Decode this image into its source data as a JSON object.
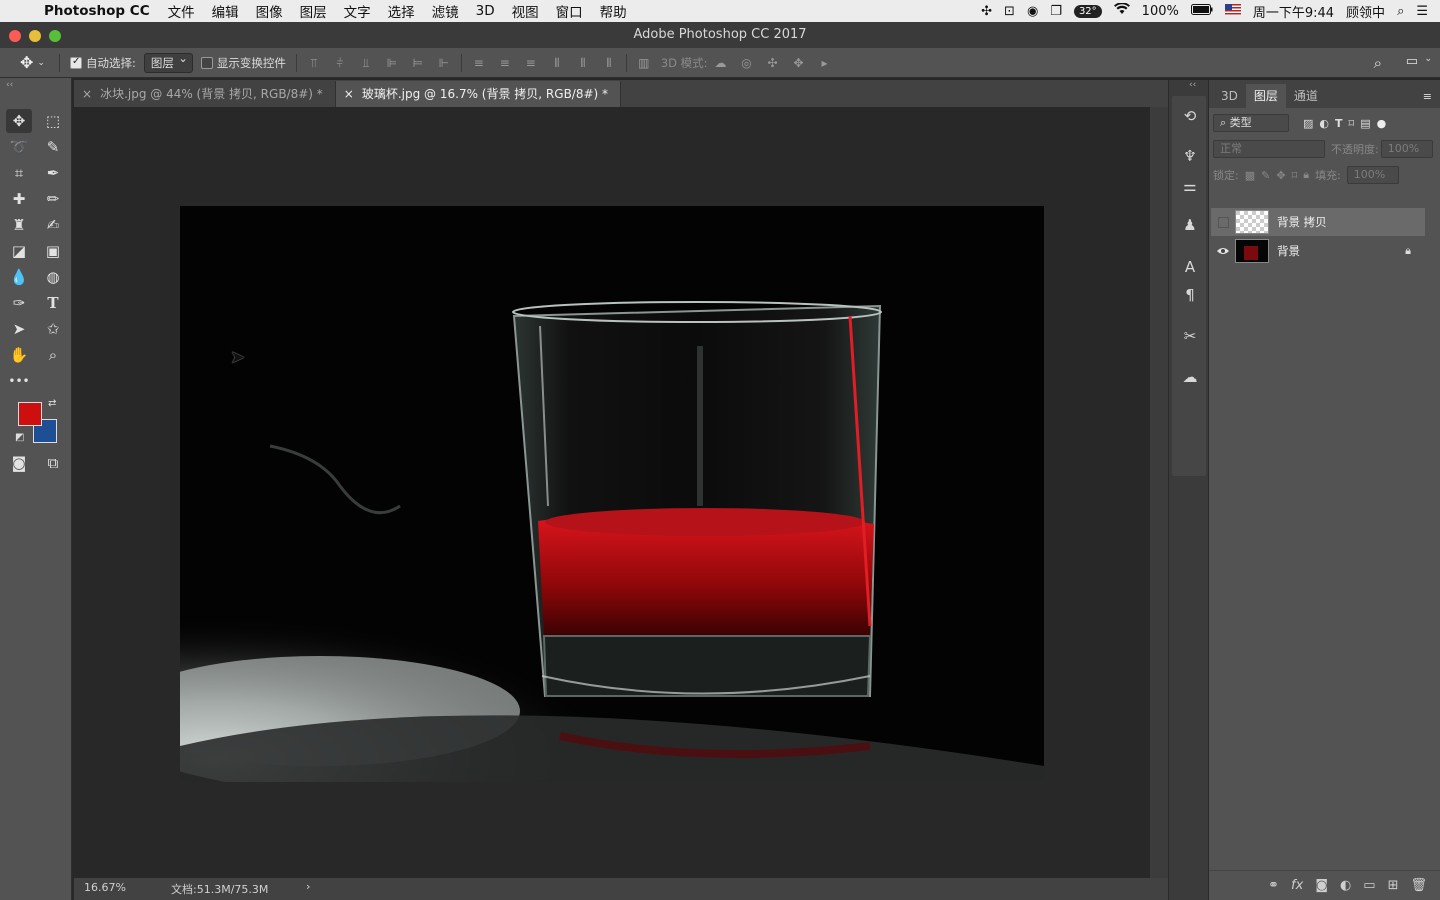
{
  "menubar": {
    "app_name": "Photoshop CC",
    "items": [
      "文件",
      "编辑",
      "图像",
      "图层",
      "文字",
      "选择",
      "滤镜",
      "3D",
      "视图",
      "窗口",
      "帮助"
    ],
    "temperature": "32°",
    "battery": "100%",
    "clock": "周一下午9:44",
    "user": "顾领中"
  },
  "window": {
    "title": "Adobe Photoshop CC 2017"
  },
  "options": {
    "auto_select_label": "自动选择:",
    "auto_select_value": "图层",
    "show_transform_label": "显示变换控件",
    "mode_3d_label": "3D 模式:"
  },
  "tabs": [
    {
      "label": "冰块.jpg @ 44% (背景 拷贝, RGB/8#) *"
    },
    {
      "label": "玻璃杯.jpg @ 16.7% (背景 拷贝, RGB/8#) *"
    }
  ],
  "colors": {
    "foreground": "#cc1010",
    "background": "#1e4f94"
  },
  "status": {
    "zoom": "16.67%",
    "doc_info": "文档:51.3M/75.3M",
    "arrow": "›"
  },
  "panel": {
    "tabs": [
      "3D",
      "图层",
      "通道"
    ],
    "filter_label": "类型",
    "blend_mode": "正常",
    "opacity_label": "不透明度:",
    "opacity_value": "100%",
    "lock_label": "锁定:",
    "fill_label": "填充:",
    "fill_value": "100%",
    "layers": [
      {
        "name": "背景 拷贝",
        "visible": false,
        "selected": true
      },
      {
        "name": "背景",
        "visible": true,
        "locked": true
      }
    ]
  }
}
